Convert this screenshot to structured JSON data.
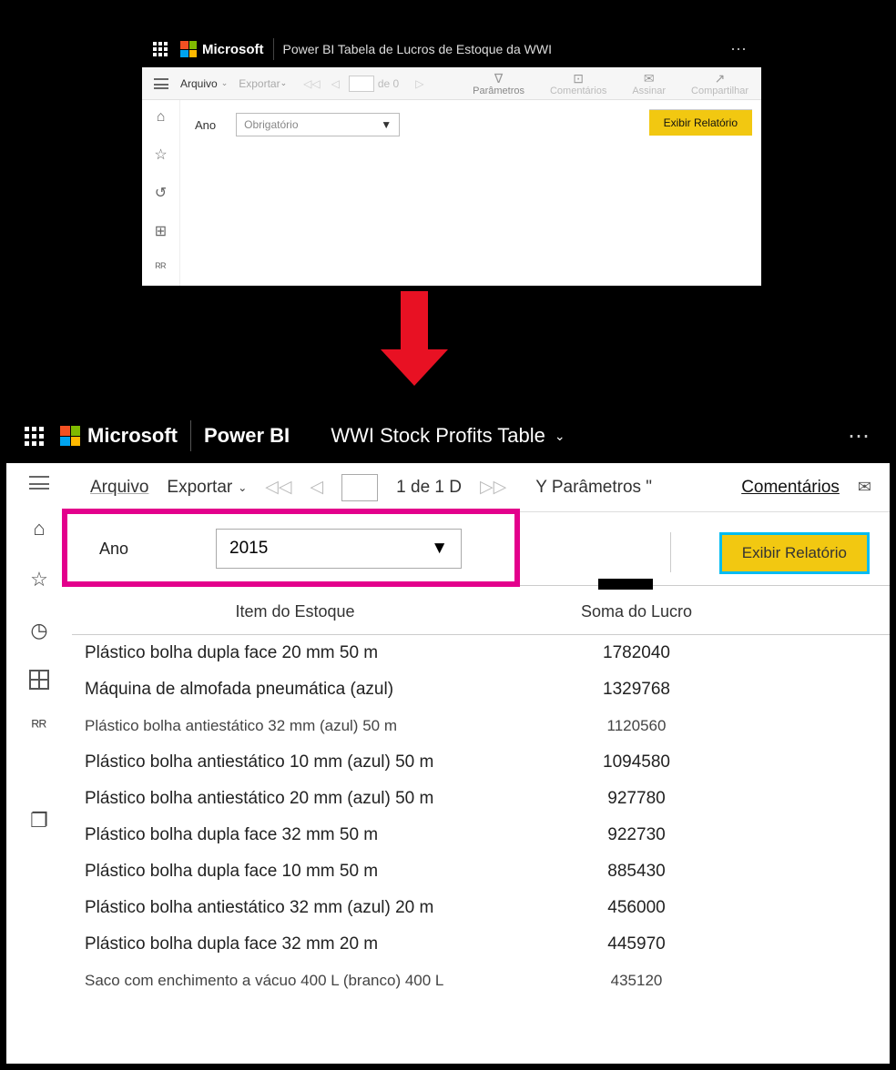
{
  "top": {
    "brand": "Microsoft",
    "app_title": "Power BI Tabela de Lucros de Estoque da WWI",
    "menu_file": "Arquivo",
    "menu_export": "Exportar",
    "page_text": "de 0",
    "group_params": "Parâmetros",
    "group_comments": "Comentários",
    "group_subscribe": "Assinar",
    "group_share": "Compartilhar",
    "param_label": "Ano",
    "param_placeholder": "Obrigatório",
    "view_btn": "Exibir Relatório"
  },
  "bot": {
    "brand": "Microsoft",
    "app": "Power BI",
    "doc_title": "WWI Stock Profits Table",
    "menu_file": "Arquivo",
    "menu_export": "Exportar",
    "page_text": "1 de 1 D",
    "params": "Parâmetros",
    "comments": "Comentários",
    "filter_label": "Ano",
    "filter_value": "2015",
    "view_btn": "Exibir Relatório",
    "col1": "Item do Estoque",
    "col2": "Soma do Lucro",
    "rows": [
      {
        "item": "Plástico bolha dupla face 20 mm 50 m",
        "val": "1782040",
        "sm": false
      },
      {
        "item": "Máquina de almofada pneumática (azul)",
        "val": "1329768",
        "sm": false
      },
      {
        "item": "Plástico bolha antiestático 32 mm (azul) 50 m",
        "val": "1120560",
        "sm": true
      },
      {
        "item": "Plástico bolha antiestático 10 mm (azul) 50 m",
        "val": "1094580",
        "sm": false
      },
      {
        "item": "Plástico bolha antiestático 20 mm (azul) 50 m",
        "val": "927780",
        "sm": false
      },
      {
        "item": "Plástico bolha dupla face 32 mm 50 m",
        "val": "922730",
        "sm": false
      },
      {
        "item": "Plástico bolha dupla face 10 mm 50 m",
        "val": "885430",
        "sm": false
      },
      {
        "item": "Plástico bolha antiestático 32 mm (azul) 20 m",
        "val": "456000",
        "sm": false
      },
      {
        "item": "Plástico bolha dupla face 32 mm 20 m",
        "val": "445970",
        "sm": false
      },
      {
        "item": "Saco com enchimento a vácuo 400 L (branco) 400 L",
        "val": "435120",
        "sm": true
      }
    ]
  }
}
